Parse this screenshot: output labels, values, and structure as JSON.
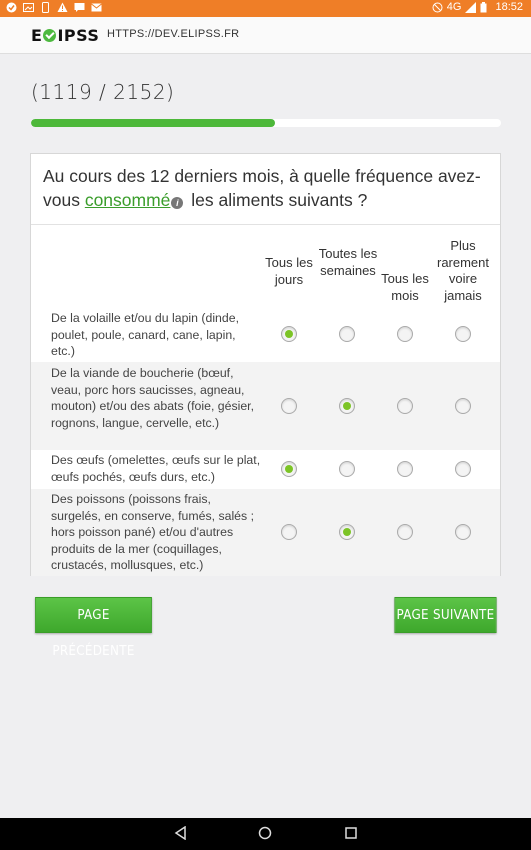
{
  "status_bar": {
    "network": "4G",
    "time": "18:52"
  },
  "header": {
    "logo_text_left": "E",
    "logo_text_right": "IPSS",
    "domain": "HTTPS://DEV.ELIPSS.FR"
  },
  "progress": {
    "counter": "(1119 / 2152)",
    "fraction": 0.52
  },
  "question": {
    "text_before": "Au cours des 12 derniers mois, à quelle fréquence avez-vous ",
    "link_text": "consommé",
    "info_glyph": "i",
    "text_after": " les aliments suivants ?"
  },
  "columns": [
    "Tous les jours",
    "Toutes les semaines",
    "Tous les mois",
    "Plus rarement voire jamais"
  ],
  "rows": [
    {
      "label": "De la volaille et/ou du lapin (dinde, poulet, poule, canard, cane, lapin, etc.)",
      "selected": 0
    },
    {
      "label": "De la viande de boucherie (bœuf, veau, porc hors saucisses, agneau, mouton) et/ou des abats (foie, gésier, rognons, langue, cervelle, etc.)",
      "selected": 1
    },
    {
      "label": "Des œufs (omelettes, œufs sur le plat, œufs pochés, œufs durs, etc.)",
      "selected": 0
    },
    {
      "label": "Des poissons (poissons frais, surgelés, en conserve, fumés, salés ; hors poisson pané) et/ou d'autres produits de la mer (coquillages, crustacés, mollusques, etc.)",
      "selected": 1
    }
  ],
  "buttons": {
    "prev": "PAGE PRÉCÉDENTE",
    "next": "PAGE SUIVANTE"
  },
  "colors": {
    "status_bar": "#ef7e27",
    "accent": "#4db83a",
    "radio_selected": "#7cc426"
  }
}
